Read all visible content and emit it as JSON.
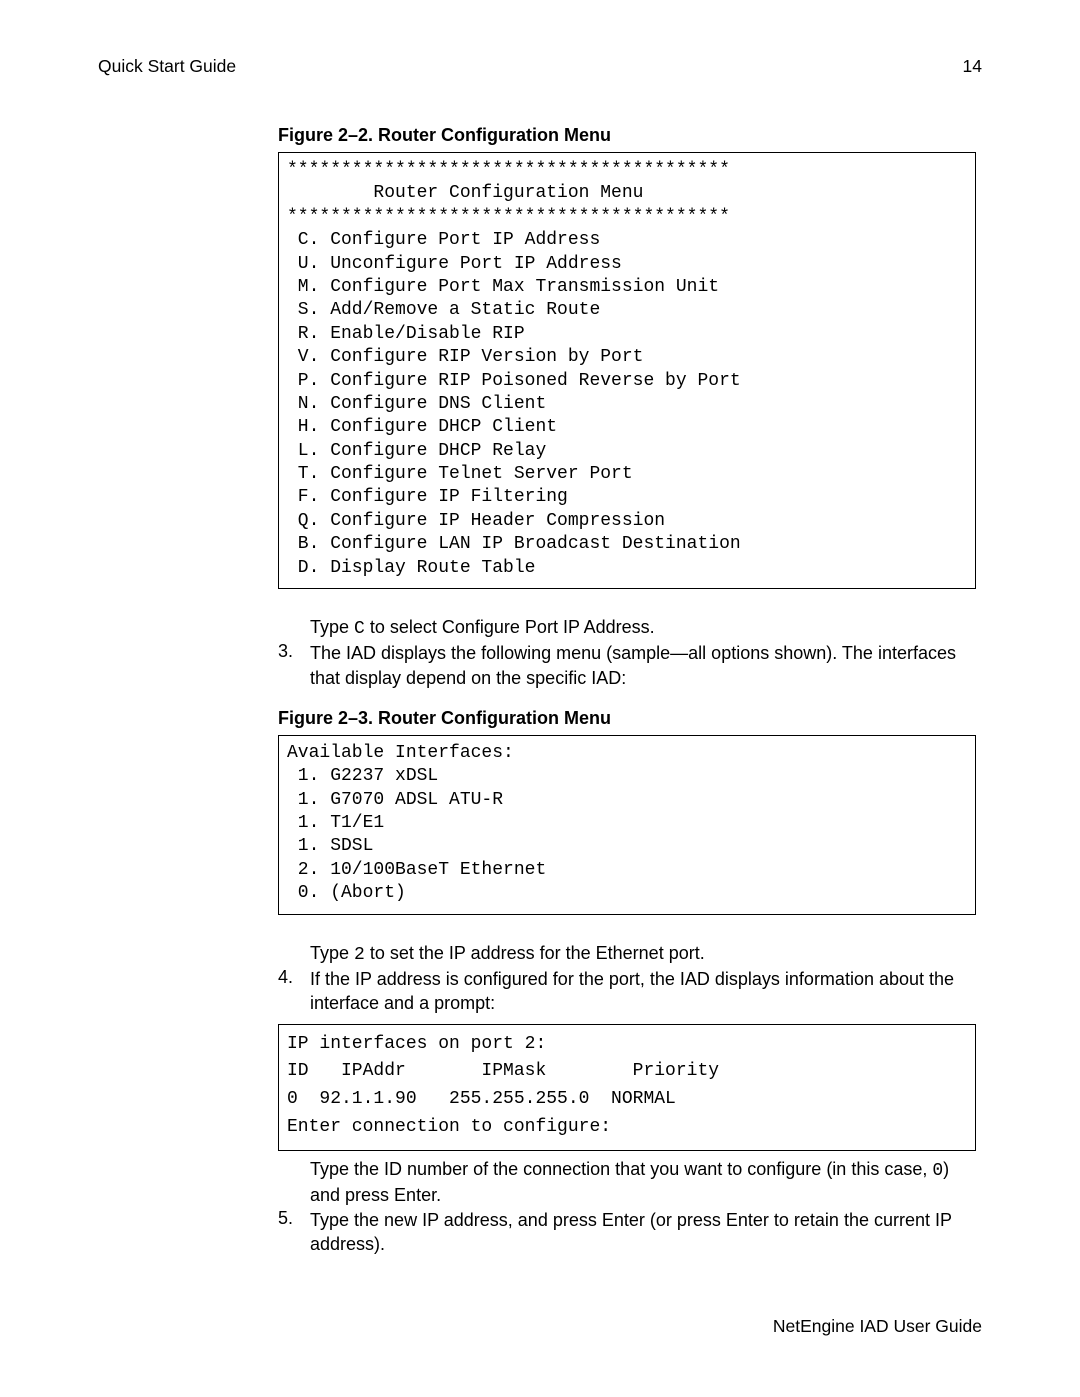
{
  "header": {
    "left": "Quick Start Guide",
    "right": "14"
  },
  "figure22": {
    "caption": "Figure 2–2.  Router Configuration Menu",
    "content": "*****************************************\n        Router Configuration Menu\n*****************************************\n C. Configure Port IP Address\n U. Unconfigure Port IP Address\n M. Configure Port Max Transmission Unit\n S. Add/Remove a Static Route\n R. Enable/Disable RIP\n V. Configure RIP Version by Port\n P. Configure RIP Poisoned Reverse by Port\n N. Configure DNS Client\n H. Configure DHCP Client\n L. Configure DHCP Relay\n T. Configure Telnet Server Port\n F. Configure IP Filtering\n Q. Configure IP Header Compression\n B. Configure LAN IP Broadcast Destination\n D. Display Route Table"
  },
  "step2_tail": {
    "pre": "Type ",
    "code": "C",
    "post": " to select Configure Port IP Address."
  },
  "step3": {
    "num": "3.",
    "text": "The IAD displays the following menu (sample—all options shown). The interfaces that display depend on the specific IAD:"
  },
  "figure23": {
    "caption": "Figure 2–3.  Router Configuration Menu",
    "content": "Available Interfaces:\n 1. G2237 xDSL\n 1. G7070 ADSL ATU-R\n 1. T1/E1\n 1. SDSL\n 2. 10/100BaseT Ethernet\n 0. (Abort)"
  },
  "step3_tail": {
    "pre": "Type ",
    "code": "2",
    "post": " to set the IP address for the Ethernet port."
  },
  "step4": {
    "num": "4.",
    "text": "If the IP address is configured for the port, the IAD displays information about the interface and a prompt:"
  },
  "ipbox": {
    "content": "IP interfaces on port 2:\nID   IPAddr       IPMask        Priority\n0  92.1.1.90   255.255.255.0  NORMAL\nEnter connection to configure:"
  },
  "step4_tail": {
    "pre": "Type the ID number of the connection that you want to configure (in this case, ",
    "code": "0",
    "post": ") and press Enter."
  },
  "step5": {
    "num": "5.",
    "text": "Type the new IP address, and press Enter (or press Enter to retain the current IP address)."
  },
  "footer": "NetEngine IAD User Guide"
}
